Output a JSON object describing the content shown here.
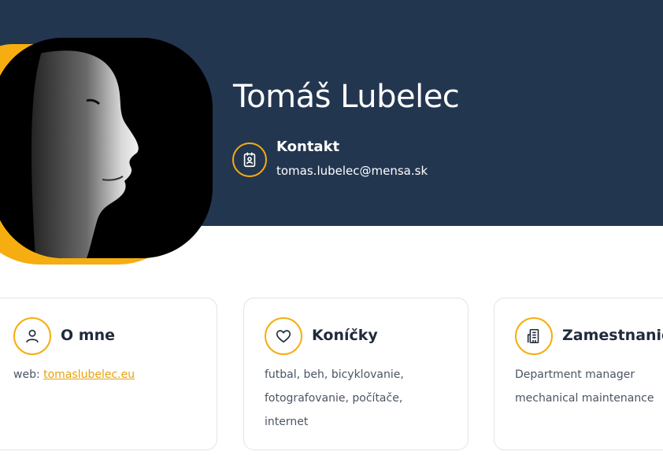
{
  "profile": {
    "name": "Tomáš Lubelec",
    "contact_title": "Kontakt",
    "email": "tomas.lubelec@mensa.sk"
  },
  "cards": {
    "about": {
      "title": "O mne",
      "web_label": "web: ",
      "web_link": "tomaslubelec.eu"
    },
    "hobbies": {
      "title": "Koníčky",
      "lines": [
        "futbal, beh, bicyklovanie,",
        "fotografovanie, počítače,",
        "internet"
      ]
    },
    "job": {
      "title": "Zamestnanie",
      "lines": [
        "Department manager",
        "mechanical maintenance"
      ]
    }
  },
  "colors": {
    "header_bg": "#233650",
    "accent": "#f6ad10"
  },
  "icons": {
    "contact": "contact-card-icon",
    "about": "user-icon",
    "hobbies": "heart-icon",
    "job": "building-icon"
  }
}
